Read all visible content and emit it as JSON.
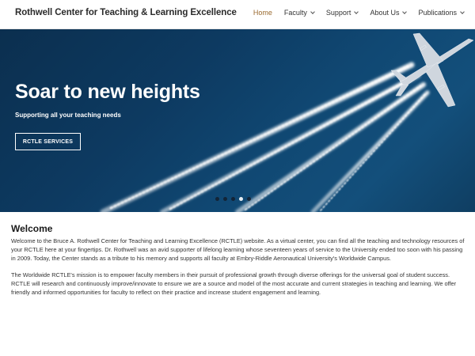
{
  "header": {
    "site_title": "Rothwell Center for Teaching & Learning Excellence",
    "nav": [
      {
        "label": "Home",
        "active": true,
        "has_dropdown": false
      },
      {
        "label": "Faculty",
        "active": false,
        "has_dropdown": true
      },
      {
        "label": "Support",
        "active": false,
        "has_dropdown": true
      },
      {
        "label": "About Us",
        "active": false,
        "has_dropdown": true
      },
      {
        "label": "Publications",
        "active": false,
        "has_dropdown": true
      }
    ]
  },
  "hero": {
    "heading": "Soar to new heights",
    "subheading": "Supporting all your teaching needs",
    "button_label": "RCTLE SERVICES",
    "slide_count": 5,
    "active_slide": 4
  },
  "content": {
    "title": "Welcome",
    "paragraphs": [
      "Welcome to the Bruce A. Rothwell Center for Teaching and Learning Excellence (RCTLE) website. As a virtual center, you can find all the teaching and technology resources of your RCTLE here at your fingertips. Dr. Rothwell was an avid supporter of lifelong learning whose seventeen years of service to the University ended too soon with his passing in 2009. Today, the Center stands as a tribute to his memory and supports all faculty at Embry-Riddle Aeronautical University's Worldwide Campus.",
      "The Worldwide RCTLE's mission is to empower faculty members in their pursuit of professional growth through diverse offerings for the universal goal of student success. RCTLE will research and continuously improve/innovate to ensure we are a source and model of the most accurate and current strategies in teaching and learning. We offer friendly and informed opportunities for faculty to reflect on their practice and increase student engagement and learning."
    ]
  },
  "colors": {
    "active_nav": "#9a6a2f",
    "hero_bg": "#0d3a61"
  },
  "icons": {
    "dropdown": "chevron-down-icon"
  }
}
